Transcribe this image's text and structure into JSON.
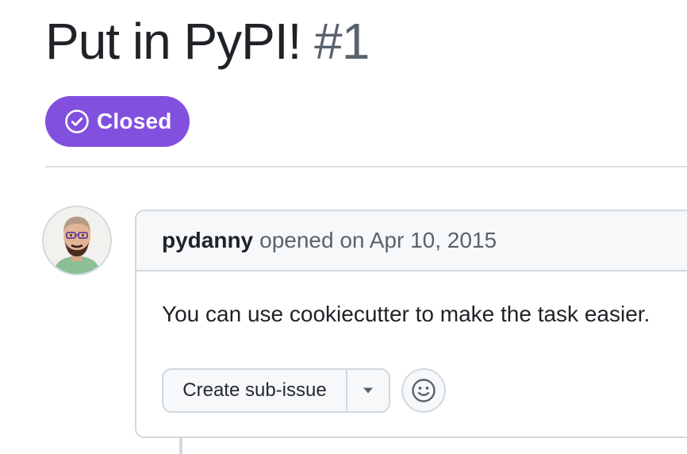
{
  "issue": {
    "title": "Put in PyPI!",
    "number": "#1"
  },
  "state_badge": {
    "label": "Closed",
    "icon": "check-circle-icon",
    "color": "#8250df"
  },
  "comment": {
    "author": "pydanny",
    "meta": "opened on Apr 10, 2015",
    "body": "You can use cookiecutter to make the task easier."
  },
  "actions": {
    "create_subissue_label": "Create sub-issue",
    "dropdown_icon": "triangle-down-icon",
    "reaction_icon": "smiley-icon"
  },
  "colors": {
    "text_primary": "#1f2328",
    "text_muted": "#59636e",
    "border": "#d1d9e0",
    "header_bg": "#f6f8fa"
  }
}
